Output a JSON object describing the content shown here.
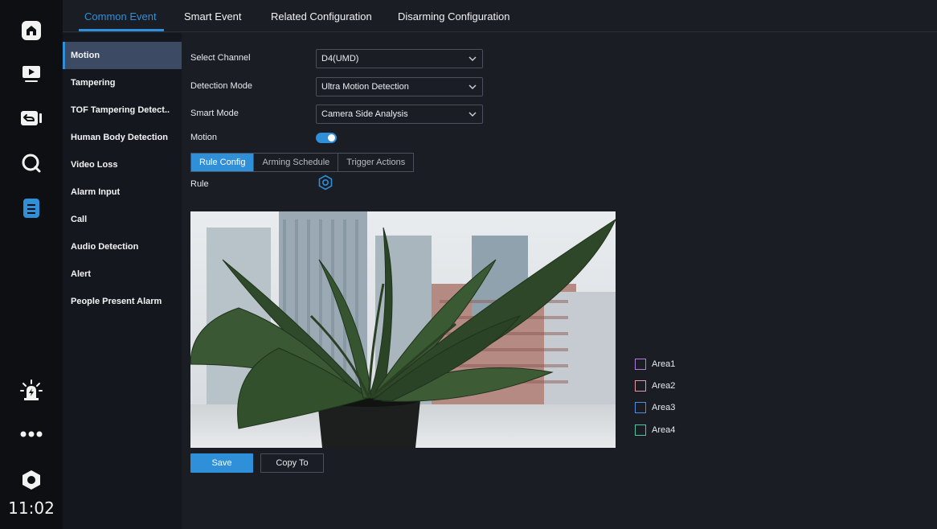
{
  "clock": "11:02",
  "rail": {
    "items": [
      {
        "icon": "home-icon"
      },
      {
        "icon": "playback-icon"
      },
      {
        "icon": "backup-icon"
      },
      {
        "icon": "search-icon"
      },
      {
        "icon": "file-settings-icon"
      },
      {
        "icon": "alarm-icon"
      },
      {
        "icon": "more-icon"
      },
      {
        "icon": "power-icon"
      }
    ]
  },
  "tabs": [
    {
      "label": "Common Event",
      "active": true
    },
    {
      "label": "Smart Event"
    },
    {
      "label": "Related Configuration"
    },
    {
      "label": "Disarming Configuration"
    }
  ],
  "sidebar": {
    "items": [
      {
        "label": "Motion",
        "active": true
      },
      {
        "label": "Tampering"
      },
      {
        "label": "TOF Tampering Detect.."
      },
      {
        "label": "Human Body Detection"
      },
      {
        "label": "Video Loss"
      },
      {
        "label": "Alarm Input"
      },
      {
        "label": "Call"
      },
      {
        "label": "Audio Detection"
      },
      {
        "label": "Alert"
      },
      {
        "label": "People Present Alarm"
      }
    ]
  },
  "form": {
    "channel": {
      "label": "Select Channel",
      "value": "D4(UMD)"
    },
    "detection_mode": {
      "label": "Detection Mode",
      "value": "Ultra Motion Detection"
    },
    "smart_mode": {
      "label": "Smart Mode",
      "value": "Camera Side Analysis"
    },
    "motion": {
      "label": "Motion",
      "enabled": true
    },
    "rule": {
      "label": "Rule"
    }
  },
  "subtabs": [
    {
      "label": "Rule Config",
      "active": true
    },
    {
      "label": "Arming Schedule"
    },
    {
      "label": "Trigger Actions"
    }
  ],
  "areas": [
    {
      "label": "Area1",
      "color": "#b57cd6"
    },
    {
      "label": "Area2",
      "color": "#e79aa6"
    },
    {
      "label": "Area3",
      "color": "#4a8fd9"
    },
    {
      "label": "Area4",
      "color": "#4fc7a0"
    }
  ],
  "buttons": {
    "save": "Save",
    "copy_to": "Copy To"
  },
  "colors": {
    "accent": "#2f8fd8",
    "background": "#1a1d24",
    "rail": "#0d0f13"
  }
}
